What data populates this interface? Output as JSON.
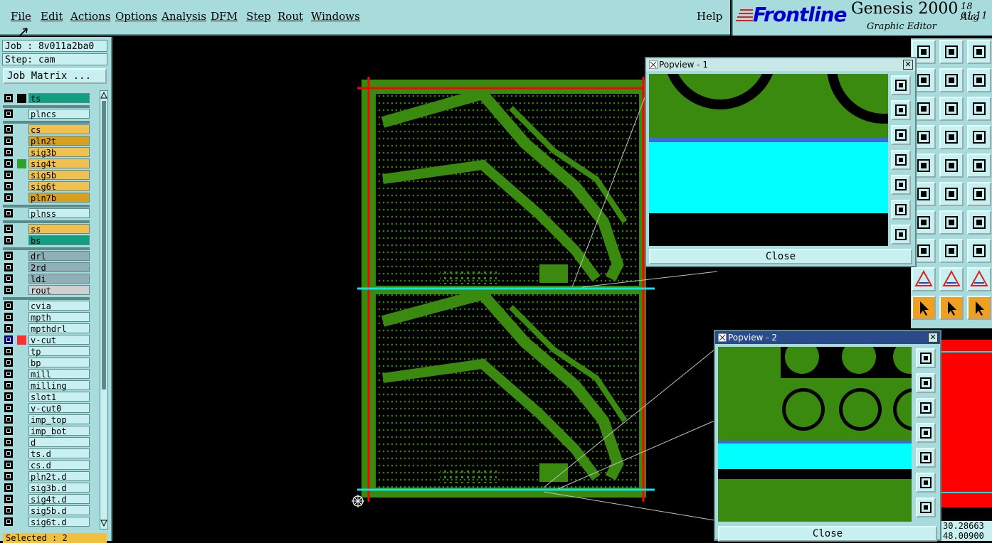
{
  "menubar": {
    "items": [
      "File",
      "Edit",
      "Actions",
      "Options",
      "Analysis",
      "DFM",
      "Step",
      "Rout",
      "Windows"
    ],
    "help": "Help"
  },
  "brand": {
    "logo": "Frontline",
    "product": "Genesis 2000",
    "subtitle": "Graphic Editor",
    "date_line1": "18 Aug",
    "date_line2": "01:11"
  },
  "left_panel": {
    "job": "Job : 8v011a2ba0",
    "step": "Step: cam",
    "job_matrix": "Job Matrix ...",
    "selected": "Selected : 2"
  },
  "layers": [
    {
      "name": "ts",
      "color": "#10a080"
    },
    {
      "name": "plncs",
      "color": "#c8f0f0"
    },
    {
      "name": "cs",
      "color": "#f0c050"
    },
    {
      "name": "pln2t",
      "color": "#d8a020"
    },
    {
      "name": "sig3b",
      "color": "#f0c050"
    },
    {
      "name": "sig4t",
      "color": "#f0c050"
    },
    {
      "name": "sig5b",
      "color": "#f0c050"
    },
    {
      "name": "sig6t",
      "color": "#f0c050"
    },
    {
      "name": "pln7b",
      "color": "#d8a020"
    },
    {
      "name": "plnss",
      "color": "#c8f0f0"
    },
    {
      "name": "ss",
      "color": "#f0c050"
    },
    {
      "name": "bs",
      "color": "#10a080"
    },
    {
      "name": "drl",
      "color": "#90b0b8"
    },
    {
      "name": "2rd",
      "color": "#90b0b8"
    },
    {
      "name": "ldi",
      "color": "#90b0b8"
    },
    {
      "name": "rout",
      "color": "#d0d0d0"
    },
    {
      "name": "cvia",
      "color": "#c8f0f0"
    },
    {
      "name": "mpth",
      "color": "#c8f0f0"
    },
    {
      "name": "mpthdrl",
      "color": "#c8f0f0"
    },
    {
      "name": "v-cut",
      "color": "#c8f0f0"
    },
    {
      "name": "tp",
      "color": "#c8f0f0"
    },
    {
      "name": "bp",
      "color": "#c8f0f0"
    },
    {
      "name": "mill",
      "color": "#c8f0f0"
    },
    {
      "name": "milling",
      "color": "#c8f0f0"
    },
    {
      "name": "slot1",
      "color": "#c8f0f0"
    },
    {
      "name": "v-cut0",
      "color": "#c8f0f0"
    },
    {
      "name": "imp_top",
      "color": "#c8f0f0"
    },
    {
      "name": "imp_bot",
      "color": "#c8f0f0"
    },
    {
      "name": "d",
      "color": "#c8f0f0"
    },
    {
      "name": "ts.d",
      "color": "#c8f0f0"
    },
    {
      "name": "cs.d",
      "color": "#c8f0f0"
    },
    {
      "name": "pln2t.d",
      "color": "#c8f0f0"
    },
    {
      "name": "sig3b.d",
      "color": "#c8f0f0"
    },
    {
      "name": "sig4t.d",
      "color": "#c8f0f0"
    },
    {
      "name": "sig5b.d",
      "color": "#c8f0f0"
    },
    {
      "name": "sig6t.d",
      "color": "#c8f0f0"
    }
  ],
  "popview1": {
    "title": "Popview - 1",
    "close": "Close"
  },
  "popview2": {
    "title": "Popview - 2",
    "close": "Close"
  },
  "coords": {
    "line1": "30.28663",
    "line2": "48.00900"
  },
  "colors": {
    "board": "#3a8a10",
    "outline": "#ff0000",
    "vcut": "#00e8f0",
    "panel": "#a8dcdc"
  }
}
